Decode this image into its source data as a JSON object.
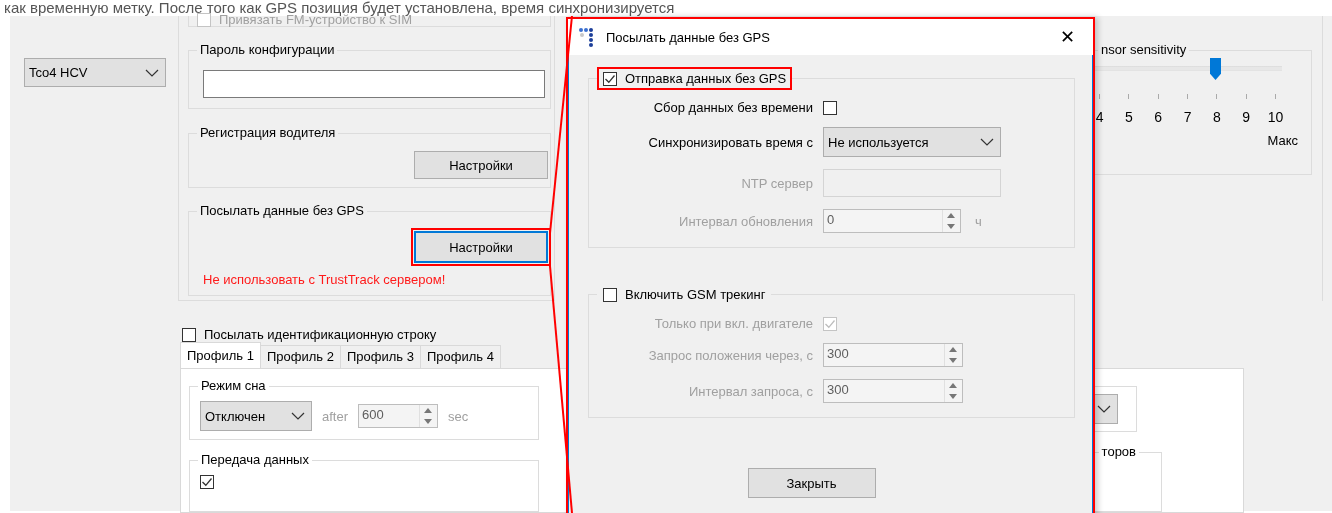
{
  "caption": "как временную метку. После того как GPS позиция будет установлена, время синхронизируется",
  "device_select": {
    "value": "Tco4 HCV"
  },
  "sim_binding": {
    "label": "Привязать FM-устройство к SIM",
    "checked": false,
    "disabled": true
  },
  "config_password": {
    "title": "Пароль конфигурации"
  },
  "driver_registration": {
    "title": "Регистрация водителя",
    "button": "Настройки"
  },
  "no_gps": {
    "title": "Посылать данные без GPS",
    "button": "Настройки",
    "focused": true,
    "highlighted": true,
    "warning": "Не использовать с TrustTrack сервером!"
  },
  "send_id_string": {
    "label": "Посылать идентификационную строку",
    "checked": false
  },
  "profile_tabs": [
    {
      "label": "Профиль 1",
      "selected": true
    },
    {
      "label": "Профиль 2",
      "selected": false
    },
    {
      "label": "Профиль 3",
      "selected": false
    },
    {
      "label": "Профиль 4",
      "selected": false
    }
  ],
  "sleep_mode": {
    "title": "Режим сна",
    "value": "Отключен",
    "after": "after",
    "seconds": "600",
    "unit": "sec",
    "disabled": true
  },
  "data_transfer": {
    "title": "Передача данных",
    "checked": true
  },
  "sensor": {
    "title": "nsor sensitivity",
    "level": 0.665,
    "ticks": [
      "4",
      "5",
      "6",
      "7",
      "8",
      "9",
      "10"
    ],
    "max_label": "Макс"
  },
  "right_group": {
    "title": "торов"
  },
  "dialog": {
    "title": "Посылать данные без GPS",
    "highlighted": true,
    "close": "✕",
    "send_without_gps": {
      "label": "Отправка данных без GPS",
      "checked": true,
      "highlighted": true,
      "rows": [
        {
          "kind": "checkbox",
          "label": "Сбор данных без времени",
          "checked": false,
          "disabled": false
        },
        {
          "kind": "select",
          "label": "Синхронизировать время с",
          "value": "Не используется",
          "disabled": false
        },
        {
          "kind": "text",
          "label": "NTP сервер",
          "disabled": true
        },
        {
          "kind": "spin",
          "label": "Интервал обновления",
          "value": "0",
          "unit": "ч",
          "disabled": true
        }
      ]
    },
    "gsm_tracking": {
      "label": "Включить GSM трекинг",
      "checked": false,
      "highlighted": false,
      "rows": [
        {
          "kind": "checkbox",
          "label": "Только при вкл. двигателе",
          "checked": true,
          "disabled": true
        },
        {
          "kind": "spin",
          "label": "Запрос положения через, с",
          "value": "300",
          "disabled": true
        },
        {
          "kind": "spin",
          "label": "Интервал запроса, с",
          "value": "300",
          "disabled": true
        }
      ]
    },
    "close_button": "Закрыть"
  }
}
